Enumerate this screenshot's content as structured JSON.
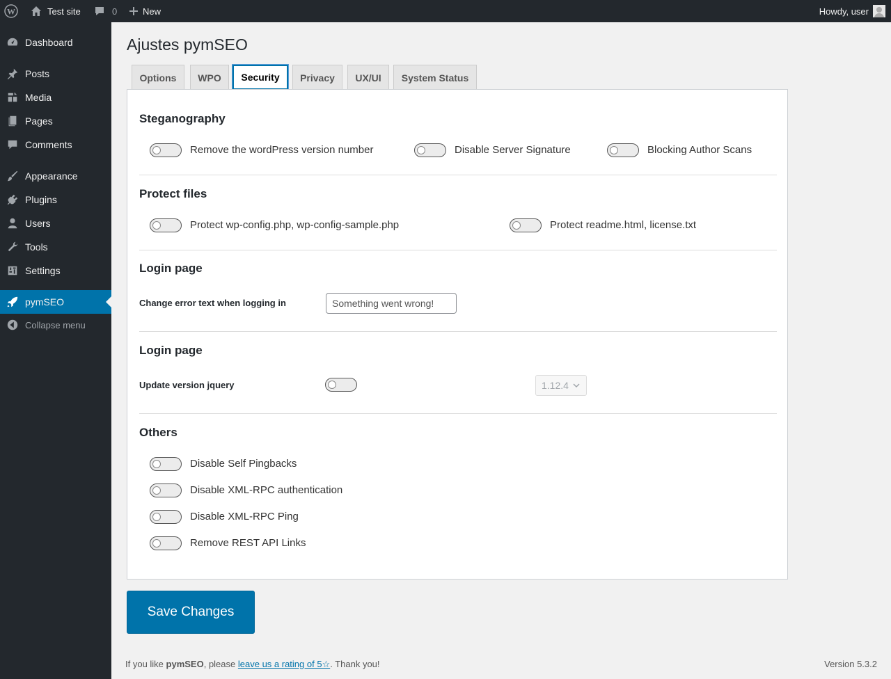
{
  "adminbar": {
    "wp_logo_icon": "wordpress-logo-icon",
    "site_name": "Test site",
    "comments_count": "0",
    "new_label": "New",
    "howdy": "Howdy, user"
  },
  "sidebar": {
    "items": [
      {
        "label": "Dashboard",
        "icon": "dashboard-icon"
      },
      {
        "label": "Posts",
        "icon": "pin-icon"
      },
      {
        "label": "Media",
        "icon": "media-icon"
      },
      {
        "label": "Pages",
        "icon": "pages-icon"
      },
      {
        "label": "Comments",
        "icon": "comment-icon"
      },
      {
        "label": "Appearance",
        "icon": "brush-icon"
      },
      {
        "label": "Plugins",
        "icon": "plug-icon"
      },
      {
        "label": "Users",
        "icon": "user-icon"
      },
      {
        "label": "Tools",
        "icon": "wrench-icon"
      },
      {
        "label": "Settings",
        "icon": "sliders-icon"
      },
      {
        "label": "pymSEO",
        "icon": "rocket-icon",
        "active": true
      }
    ],
    "collapse_label": "Collapse menu"
  },
  "page": {
    "title": "Ajustes pymSEO",
    "tabs": [
      "Options",
      "WPO",
      "Security",
      "Privacy",
      "UX/UI",
      "System Status"
    ],
    "active_tab": "Security"
  },
  "sections": {
    "steganography": {
      "title": "Steganography",
      "toggles": [
        "Remove the wordPress version number",
        "Disable Server Signature",
        "Blocking Author Scans"
      ]
    },
    "protect_files": {
      "title": "Protect files",
      "toggles": [
        "Protect wp-config.php, wp-config-sample.php",
        "Protect readme.html, license.txt"
      ]
    },
    "login_page": {
      "title": "Login page",
      "error_text_label": "Change error text when logging in",
      "error_text_value": "Something went wrong!"
    },
    "login_page_2": {
      "title": "Login page",
      "jquery_label": "Update version jquery",
      "jquery_version": "1.12.4"
    },
    "others": {
      "title": "Others",
      "toggles": [
        "Disable Self Pingbacks",
        "Disable XML-RPC authentication",
        "Disable XML-RPC Ping",
        "Remove REST API Links"
      ]
    }
  },
  "save_label": "Save Changes",
  "footer": {
    "prefix": "If you like ",
    "plugin": "pymSEO",
    "middle": ", please ",
    "link": "leave us a rating of 5☆",
    "suffix": ". Thank you!",
    "version": "Version 5.3.2"
  },
  "colors": {
    "accent": "#0073aa",
    "sidebar_bg": "#23282d",
    "background": "#f1f1f1"
  }
}
